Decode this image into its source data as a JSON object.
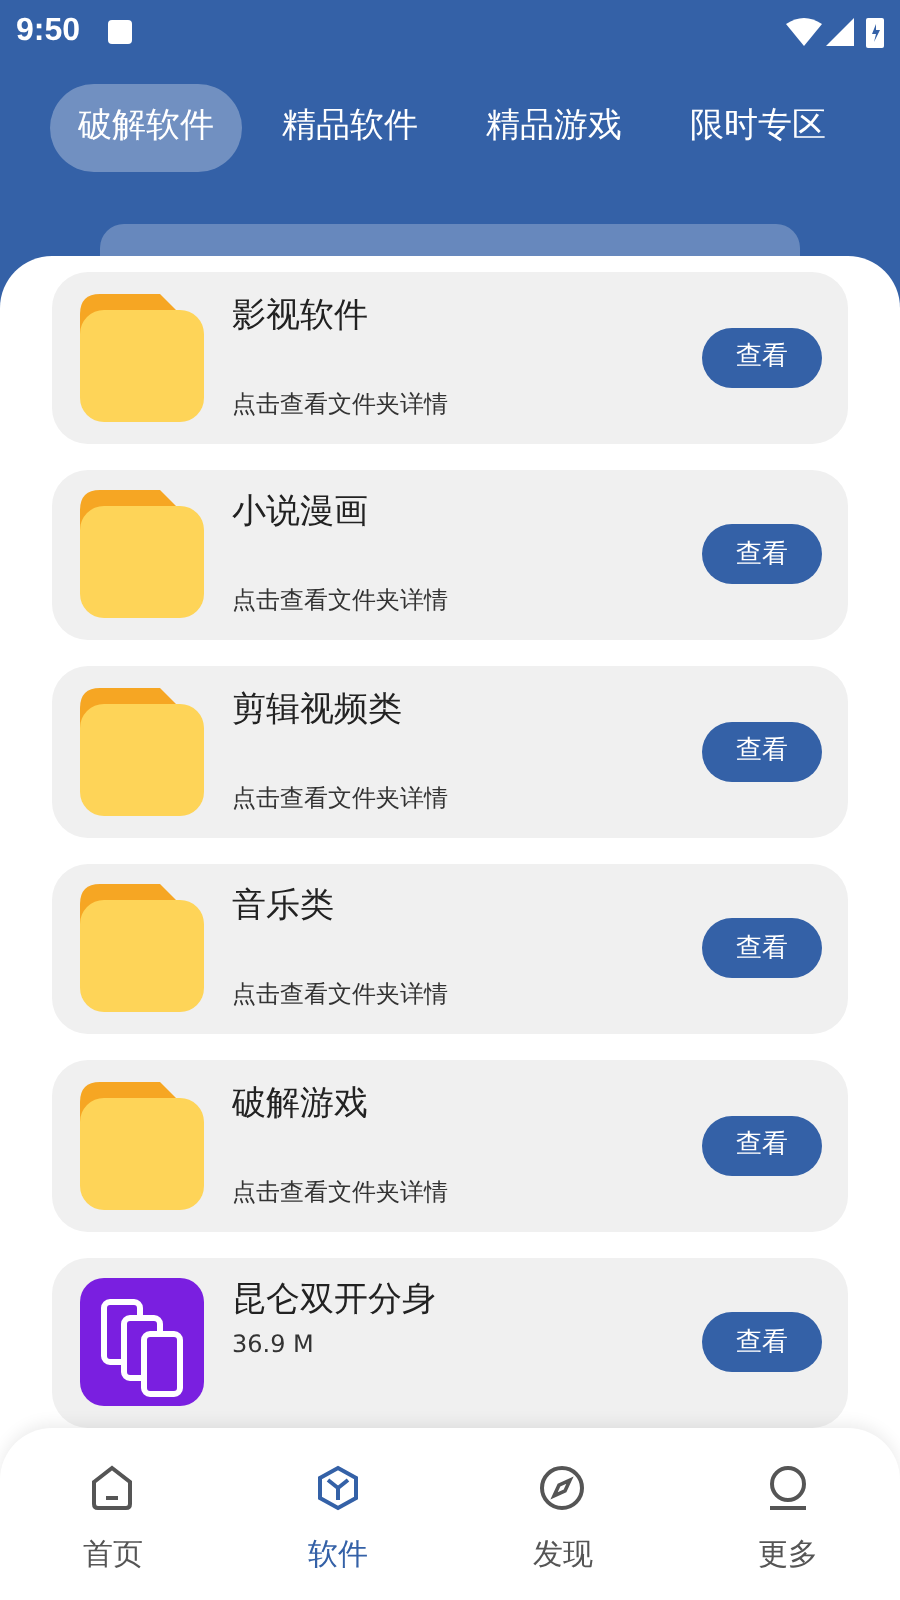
{
  "status_bar": {
    "time": "9:50"
  },
  "tabs": [
    {
      "label": "破解软件",
      "selected": true
    },
    {
      "label": "精品软件",
      "selected": false
    },
    {
      "label": "精品游戏",
      "selected": false
    },
    {
      "label": "限时专区",
      "selected": false
    }
  ],
  "items": [
    {
      "kind": "folder",
      "title": "影视软件",
      "subtitle": "点击查看文件夹详情",
      "button": "查看"
    },
    {
      "kind": "folder",
      "title": "小说漫画",
      "subtitle": "点击查看文件夹详情",
      "button": "查看"
    },
    {
      "kind": "folder",
      "title": "剪辑视频类",
      "subtitle": "点击查看文件夹详情",
      "button": "查看"
    },
    {
      "kind": "folder",
      "title": "音乐类",
      "subtitle": "点击查看文件夹详情",
      "button": "查看"
    },
    {
      "kind": "folder",
      "title": "破解游戏",
      "subtitle": "点击查看文件夹详情",
      "button": "查看"
    },
    {
      "kind": "app",
      "title": "昆仑双开分身",
      "size": "36.9 M",
      "button": "查看"
    }
  ],
  "bottom_nav": [
    {
      "kind": "home",
      "label": "首页",
      "selected": false
    },
    {
      "kind": "cube",
      "label": "软件",
      "selected": true
    },
    {
      "kind": "compass",
      "label": "发现",
      "selected": false
    },
    {
      "kind": "person",
      "label": "更多",
      "selected": false
    }
  ]
}
